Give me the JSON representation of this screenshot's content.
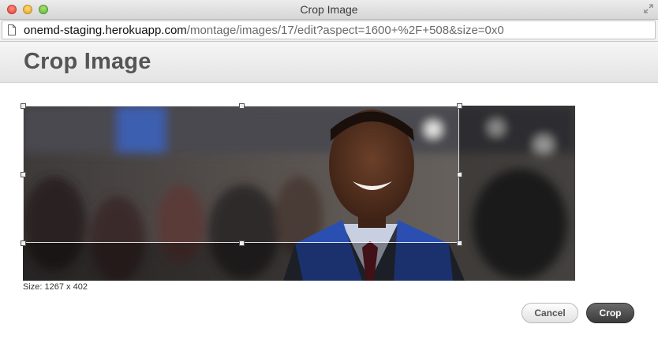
{
  "window": {
    "title": "Crop Image"
  },
  "address_bar": {
    "host": "onemd-staging.herokuapp.com",
    "path": "/montage/images/17/edit?aspect=1600+%2F+508&size=0x0"
  },
  "page": {
    "heading": "Crop Image"
  },
  "crop": {
    "size_label": "Size: 1267 x 402"
  },
  "actions": {
    "cancel_label": "Cancel",
    "crop_label": "Crop"
  },
  "colors": {
    "gown_blue": "#2a4fb0",
    "page_header": "#e9e9e9",
    "primary_button": "#4a4a4a"
  }
}
